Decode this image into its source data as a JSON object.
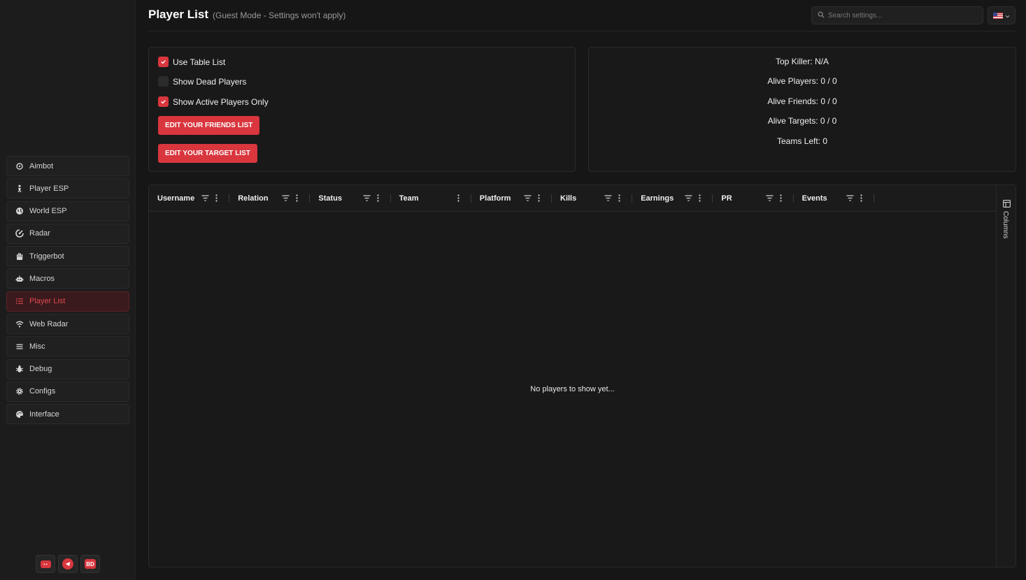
{
  "header": {
    "title": "Player List",
    "subtitle": "(Guest Mode - Settings won't apply)",
    "search_placeholder": "Search settings..."
  },
  "sidebar": {
    "items": [
      {
        "label": "Aimbot",
        "icon": "crosshair-icon"
      },
      {
        "label": "Player ESP",
        "icon": "person-icon"
      },
      {
        "label": "World ESP",
        "icon": "globe-icon"
      },
      {
        "label": "Radar",
        "icon": "radar-icon"
      },
      {
        "label": "Triggerbot",
        "icon": "hand-icon"
      },
      {
        "label": "Macros",
        "icon": "robot-icon"
      },
      {
        "label": "Player List",
        "icon": "list-icon",
        "active": true
      },
      {
        "label": "Web Radar",
        "icon": "wifi-icon"
      },
      {
        "label": "Misc",
        "icon": "menu-icon"
      },
      {
        "label": "Debug",
        "icon": "bug-icon"
      },
      {
        "label": "Configs",
        "icon": "gear-icon"
      },
      {
        "label": "Interface",
        "icon": "palette-icon"
      }
    ],
    "social": [
      {
        "icon": "discord-icon"
      },
      {
        "icon": "telegram-icon"
      },
      {
        "icon": "bd-logo-icon",
        "text": "BD"
      }
    ]
  },
  "options": {
    "use_table_list": {
      "label": "Use Table List",
      "checked": true
    },
    "show_dead_players": {
      "label": "Show Dead Players",
      "checked": false
    },
    "show_active_only": {
      "label": "Show Active Players Only",
      "checked": true
    },
    "edit_friends": "EDIT YOUR FRIENDS LIST",
    "edit_targets": "EDIT YOUR TARGET LIST"
  },
  "stats": {
    "top_killer": "Top Killer: N/A",
    "alive_players": "Alive Players: 0 / 0",
    "alive_friends": "Alive Friends: 0 / 0",
    "alive_targets": "Alive Targets: 0 / 0",
    "teams_left": "Teams Left: 0"
  },
  "table": {
    "columns": [
      {
        "label": "Username",
        "filter": true
      },
      {
        "label": "Relation",
        "filter": true
      },
      {
        "label": "Status",
        "filter": true
      },
      {
        "label": "Team",
        "filter": false
      },
      {
        "label": "Platform",
        "filter": true
      },
      {
        "label": "Kills",
        "filter": true
      },
      {
        "label": "Earnings",
        "filter": true
      },
      {
        "label": "PR",
        "filter": true
      },
      {
        "label": "Events",
        "filter": true
      }
    ],
    "empty_text": "No players to show yet...",
    "side_panel_label": "Columns"
  },
  "colors": {
    "accent": "#d9363e",
    "background": "#161616"
  }
}
